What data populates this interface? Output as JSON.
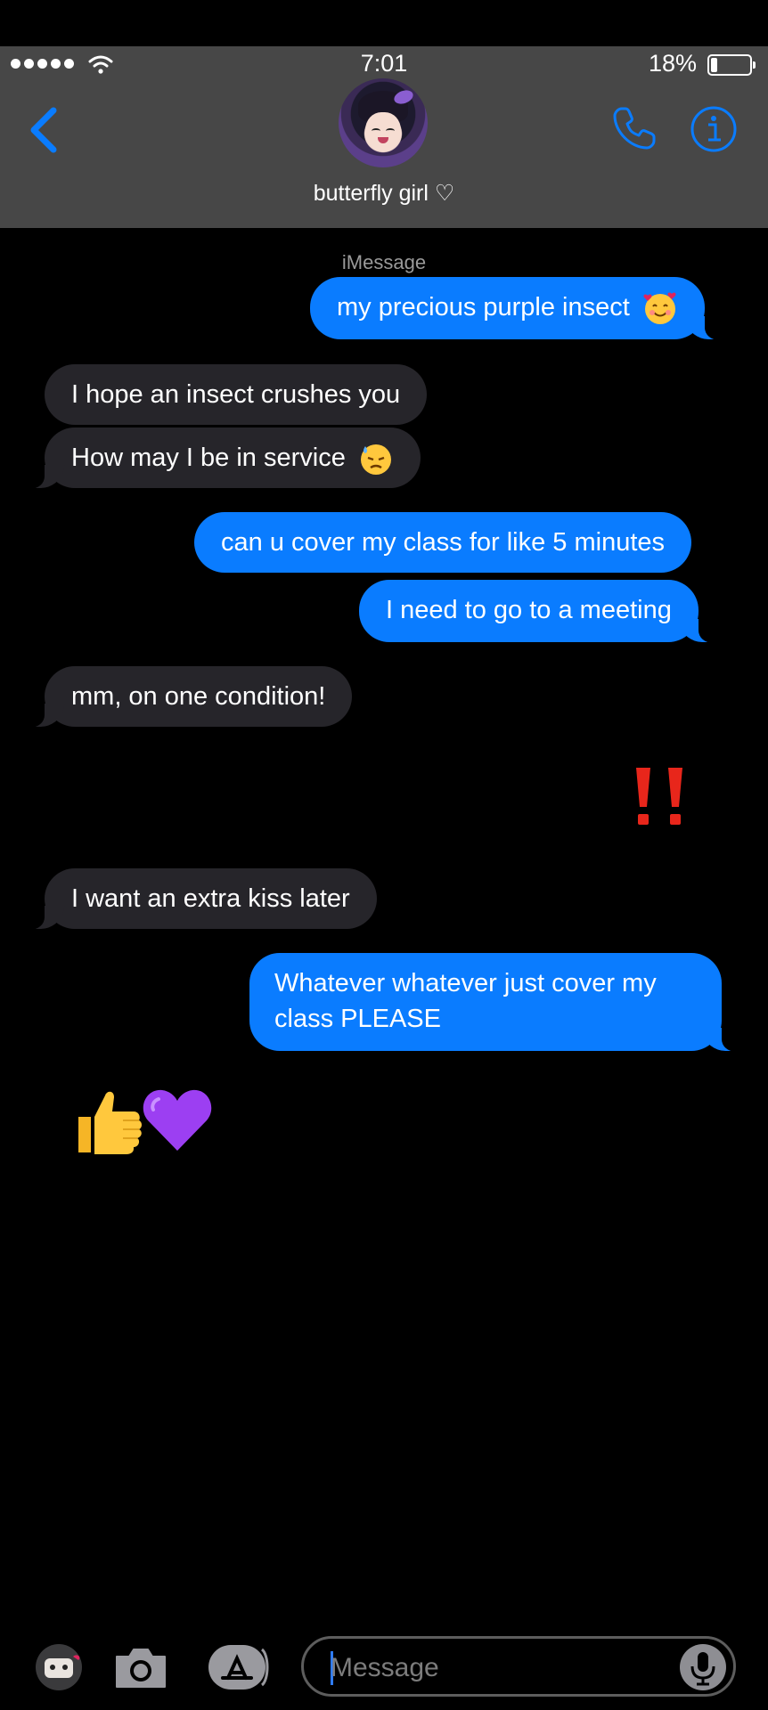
{
  "status_bar": {
    "time": "7:01",
    "battery": "18%"
  },
  "header": {
    "contact_name": "butterfly girl ♡"
  },
  "thread": {
    "service_label": "iMessage",
    "messages": [
      {
        "from": "me",
        "text": "my precious purple insect",
        "emoji": "smiling-face-with-hearts"
      },
      {
        "from": "them",
        "text": "I hope an insect crushes you"
      },
      {
        "from": "them",
        "text": "How may I be in service",
        "emoji": "downcast-face-with-sweat"
      },
      {
        "from": "me",
        "text": "can u cover my class for like 5 minutes"
      },
      {
        "from": "me",
        "text": "I need to go to a meeting"
      },
      {
        "from": "them",
        "text": "mm, on one condition!"
      },
      {
        "from": "me",
        "emoji": "double-exclamation-mark"
      },
      {
        "from": "them",
        "text": "I want an extra kiss later"
      },
      {
        "from": "me",
        "text": "Whatever whatever just cover my class PLEASE"
      },
      {
        "from": "them",
        "emoji": "thumbs-up purple-heart"
      }
    ]
  },
  "composer": {
    "placeholder": "Message"
  },
  "colors": {
    "sent_bubble": "#0a7cff",
    "received_bubble": "#26252a",
    "header_bg": "#474747",
    "accent": "#0a7cff"
  }
}
